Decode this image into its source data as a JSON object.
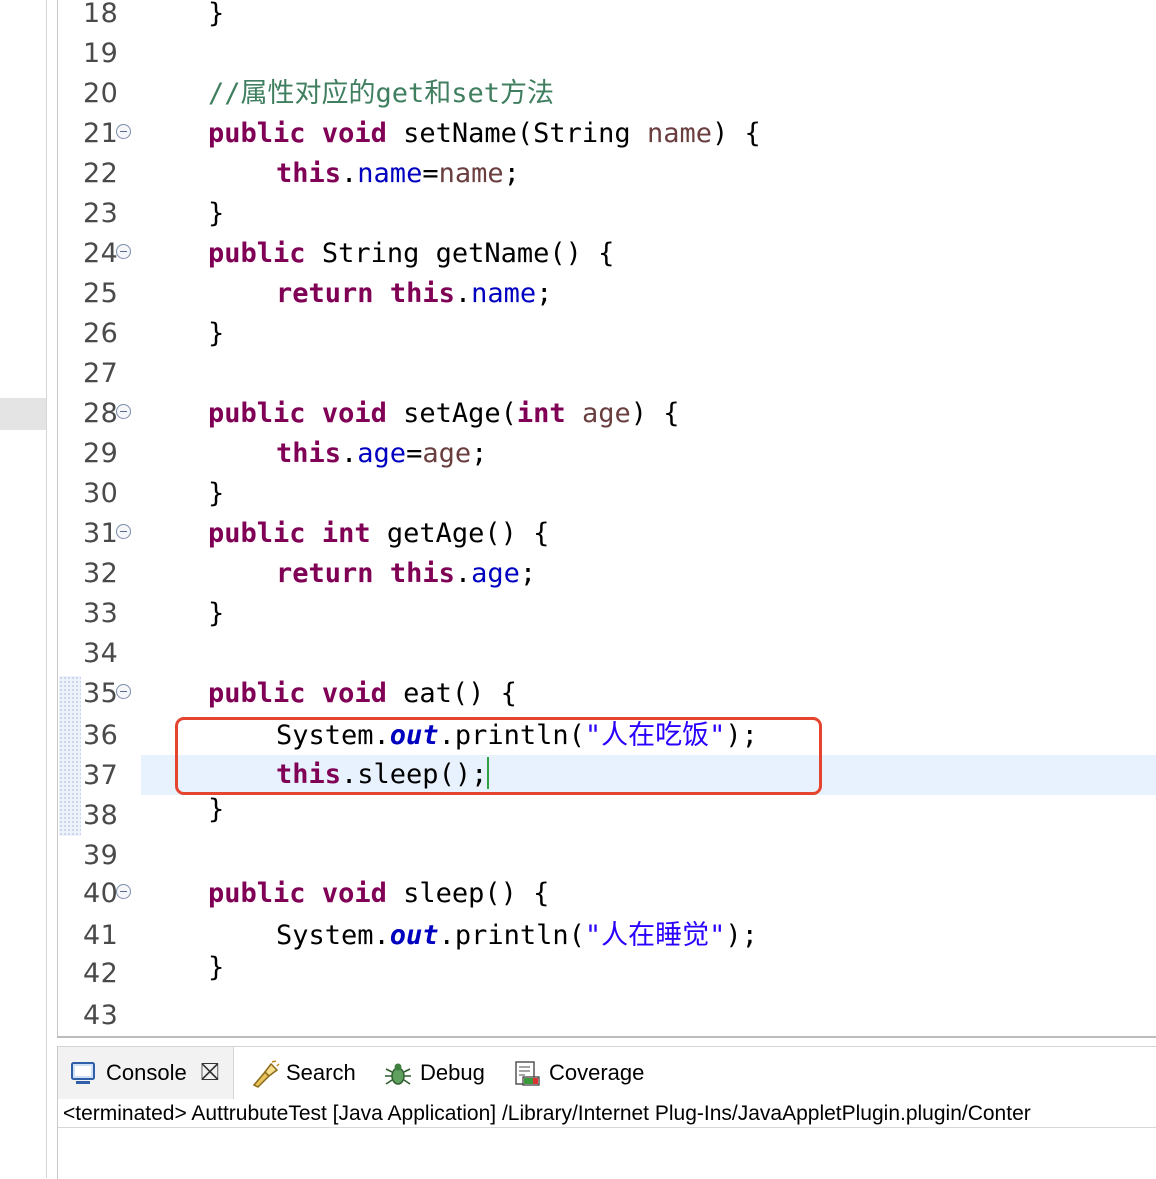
{
  "editor": {
    "lines": [
      {
        "num": "18"
      },
      {
        "num": "19"
      },
      {
        "num": "20"
      },
      {
        "num": "21"
      },
      {
        "num": "22"
      },
      {
        "num": "23"
      },
      {
        "num": "24"
      },
      {
        "num": "25"
      },
      {
        "num": "26"
      },
      {
        "num": "27"
      },
      {
        "num": "28"
      },
      {
        "num": "29"
      },
      {
        "num": "30"
      },
      {
        "num": "31"
      },
      {
        "num": "32"
      },
      {
        "num": "33"
      },
      {
        "num": "34"
      },
      {
        "num": "35"
      },
      {
        "num": "36"
      },
      {
        "num": "37"
      },
      {
        "num": "38"
      },
      {
        "num": "39"
      },
      {
        "num": "40"
      },
      {
        "num": "41"
      },
      {
        "num": "42"
      },
      {
        "num": "43"
      }
    ],
    "tokens": {
      "brace_close": "}",
      "comment": "//属性对应的get和set方法",
      "kw_public": "public",
      "kw_void": "void",
      "kw_this": "this",
      "kw_return": "return",
      "kw_int": "int",
      "set_name_sig": "setName(String ",
      "param_name": "name",
      "paren_brace": ") {",
      "dot": ".",
      "field_name": "name",
      "assign": "=",
      "semi": ";",
      "get_name_sig": "String getName() {",
      "set_age_sig": "setAge(",
      "param_age": "age",
      "field_age": "age",
      "get_age_sig": "getAge() {",
      "eat_sig": "eat() {",
      "system": "System.",
      "out": "out",
      "println_open": ".println(",
      "str_eat": "\"人在吃饭\"",
      "println_close": ");",
      "sleep_call": ".sleep();",
      "sleep_sig": "sleep() {",
      "str_sleep": "\"人在睡觉\""
    }
  },
  "console": {
    "tabs": [
      {
        "label": "Console",
        "icon": "console-icon",
        "close": "⛝"
      },
      {
        "label": "Search",
        "icon": "search-flashlight-icon"
      },
      {
        "label": "Debug",
        "icon": "debug-bug-icon"
      },
      {
        "label": "Coverage",
        "icon": "coverage-icon"
      }
    ],
    "status": "<terminated> AuttrubuteTest [Java Application] /Library/Internet Plug-Ins/JavaAppletPlugin.plugin/Conter"
  },
  "colors": {
    "keyword": "#7f0055",
    "field": "#0000c0",
    "local_var": "#6a3e3e",
    "comment": "#3f7f5f",
    "string": "#2a00ff",
    "highlight_box": "#e5452f",
    "current_line": "#e8f2fe"
  }
}
